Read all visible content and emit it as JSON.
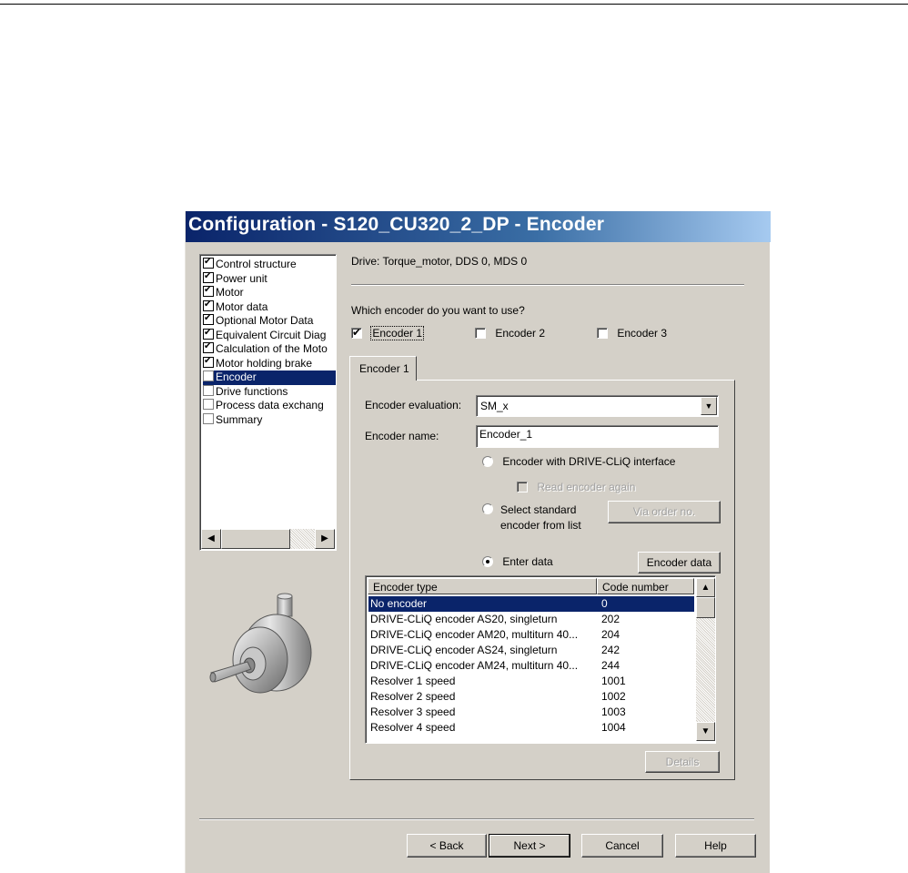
{
  "dialog": {
    "title": "Configuration - S120_CU320_2_DP - Encoder",
    "drive_info": "Drive: Torque_motor, DDS 0, MDS 0",
    "question": "Which encoder do you want to use?"
  },
  "tree": {
    "items": [
      {
        "label": "Control structure",
        "checked": true
      },
      {
        "label": "Power unit",
        "checked": true
      },
      {
        "label": "Motor",
        "checked": true
      },
      {
        "label": "Motor data",
        "checked": true
      },
      {
        "label": "Optional Motor Data",
        "checked": true
      },
      {
        "label": "Equivalent Circuit Diag",
        "checked": true
      },
      {
        "label": "Calculation of the Moto",
        "checked": true
      },
      {
        "label": "Motor holding brake",
        "checked": true
      },
      {
        "label": "Encoder",
        "checked": false,
        "selected": true
      },
      {
        "label": "Drive functions",
        "checked": false
      },
      {
        "label": "Process data exchang",
        "checked": false
      },
      {
        "label": "Summary",
        "checked": false
      }
    ]
  },
  "encoders": {
    "enc1": "Encoder 1",
    "enc2": "Encoder 2",
    "enc3": "Encoder 3"
  },
  "tab": {
    "label": "Encoder 1"
  },
  "form": {
    "evaluation_label": "Encoder evaluation:",
    "evaluation_value": "SM_x",
    "name_label": "Encoder name:",
    "name_value": "Encoder_1",
    "radio_driveq": "Encoder with DRIVE-CLiQ interface",
    "read_again": "Read encoder again",
    "radio_standard_l1": "Select standard",
    "radio_standard_l2": "encoder from list",
    "via_order": "Via order no.",
    "radio_enter": "Enter data",
    "encoder_data_btn": "Encoder data",
    "details_btn": "Details"
  },
  "table": {
    "col1": "Encoder type",
    "col2": "Code number",
    "rows": [
      {
        "type": "No encoder",
        "code": "0"
      },
      {
        "type": "DRIVE-CLiQ encoder AS20, singleturn",
        "code": "202"
      },
      {
        "type": "DRIVE-CLiQ encoder AM20, multiturn 40...",
        "code": "204"
      },
      {
        "type": "DRIVE-CLiQ encoder AS24, singleturn",
        "code": "242"
      },
      {
        "type": "DRIVE-CLiQ encoder AM24, multiturn 40...",
        "code": "244"
      },
      {
        "type": "Resolver 1 speed",
        "code": "1001"
      },
      {
        "type": "Resolver 2 speed",
        "code": "1002"
      },
      {
        "type": "Resolver 3 speed",
        "code": "1003"
      },
      {
        "type": "Resolver 4 speed",
        "code": "1004"
      }
    ]
  },
  "footer": {
    "back": "< Back",
    "next": "Next >",
    "cancel": "Cancel",
    "help": "Help"
  }
}
